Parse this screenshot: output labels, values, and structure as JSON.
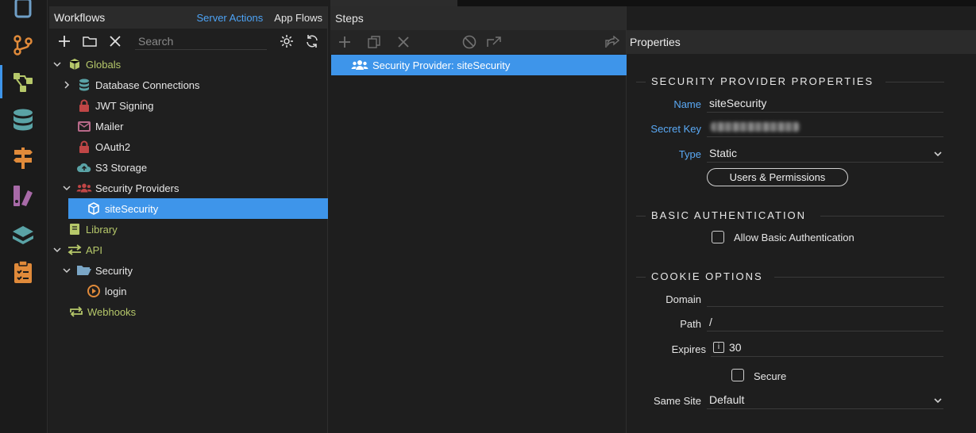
{
  "workflows": {
    "title": "Workflows",
    "links": {
      "server_actions": "Server Actions",
      "app_flows": "App Flows"
    },
    "search_placeholder": "Search",
    "tree": {
      "globals": "Globals",
      "database_connections": "Database Connections",
      "jwt_signing": "JWT Signing",
      "mailer": "Mailer",
      "oauth2": "OAuth2",
      "s3_storage": "S3 Storage",
      "security_providers": "Security Providers",
      "site_security": "siteSecurity",
      "library": "Library",
      "api": "API",
      "security": "Security",
      "login": "login",
      "webhooks": "Webhooks"
    }
  },
  "steps": {
    "title": "Steps",
    "selected_step": "Security Provider: siteSecurity"
  },
  "properties": {
    "title": "Properties",
    "security_provider": {
      "section": "SECURITY PROVIDER PROPERTIES",
      "name_label": "Name",
      "name_value": "siteSecurity",
      "secret_key_label": "Secret Key",
      "type_label": "Type",
      "type_value": "Static",
      "users_button": "Users & Permissions"
    },
    "basic_auth": {
      "section": "BASIC AUTHENTICATION",
      "allow_label": "Allow Basic Authentication"
    },
    "cookie": {
      "section": "COOKIE OPTIONS",
      "domain_label": "Domain",
      "domain_value": "",
      "path_label": "Path",
      "path_value": "/",
      "expires_label": "Expires",
      "expires_value": "30",
      "secure_label": "Secure",
      "same_site_label": "Same Site",
      "same_site_value": "Default"
    }
  },
  "colors": {
    "accent": "#3e95ea",
    "green": "#b6c86a",
    "red": "#c04646",
    "teal": "#5aa3a6",
    "orange": "#e08a3a"
  }
}
